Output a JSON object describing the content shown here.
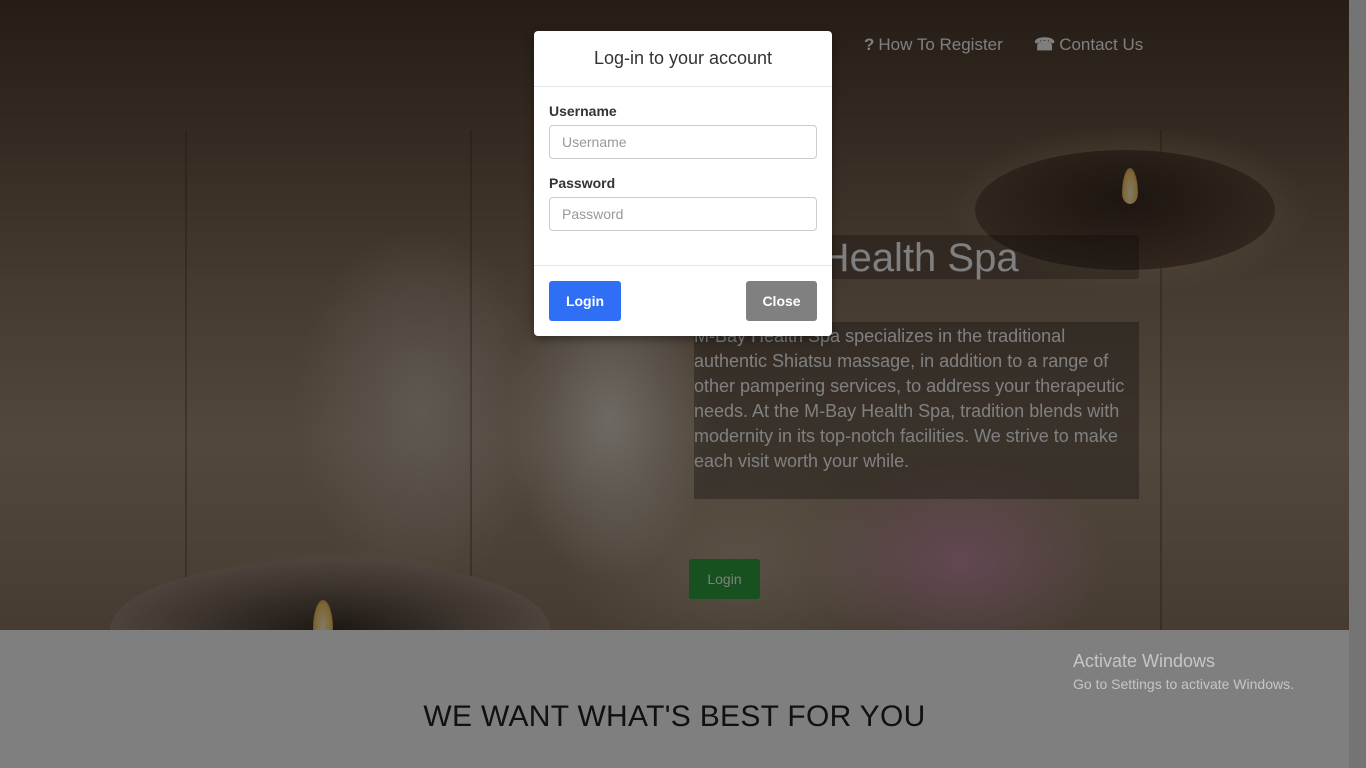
{
  "nav": {
    "how_to_register": {
      "icon": "?",
      "label": "How To Register"
    },
    "contact_us": {
      "icon": "☎",
      "label": "Contact Us"
    }
  },
  "hero": {
    "title": "M-Bay Health Spa",
    "description": "M-Bay Health Spa specializes in the traditional authentic Shiatsu massage, in addition to a range of other pampering services, to address your therapeutic needs. At the M-Bay Health Spa, tradition blends with modernity in its top-notch facilities. We strive to make each visit worth your while.",
    "login_label": "Login"
  },
  "lower": {
    "heading": "WE WANT WHAT'S BEST FOR YOU"
  },
  "modal": {
    "title": "Log-in to your account",
    "username_label": "Username",
    "username_placeholder": "Username",
    "username_value": "",
    "password_label": "Password",
    "password_placeholder": "Password",
    "password_value": "",
    "login_label": "Login",
    "close_label": "Close"
  },
  "watermark": {
    "title": "Activate Windows",
    "subtitle": "Go to Settings to activate Windows."
  },
  "colors": {
    "modal_login_button": "#2f6ff6",
    "modal_close_button": "#808080",
    "hero_login_button": "#2fa33e"
  }
}
